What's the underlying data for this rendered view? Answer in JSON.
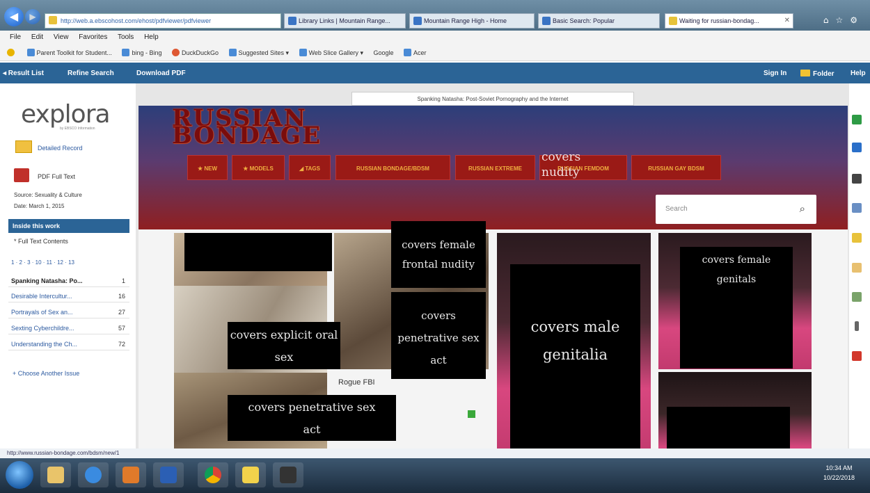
{
  "browser": {
    "address": "http://web.a.ebscohost.com/ehost/pdfviewer/pdfviewer",
    "tabs": [
      {
        "label": "Library Links | Mountain Range..."
      },
      {
        "label": "Mountain Range High - Home"
      },
      {
        "label": "Basic Search: Popular"
      },
      {
        "label": "Waiting for russian-bondag..."
      }
    ],
    "menu": [
      "File",
      "Edit",
      "View",
      "Favorites",
      "Tools",
      "Help"
    ],
    "favorites": [
      "Parent Toolkit for Student...",
      "bing - Bing",
      "DuckDuckGo",
      "Suggested Sites ▾",
      "Web Slice Gallery ▾",
      "Google",
      "Acer"
    ]
  },
  "toolbar": {
    "result_list": "◂ Result List",
    "refine_search": "Refine Search",
    "download_pdf": "Download PDF",
    "sign_in": "Sign In",
    "folder": "Folder",
    "help": "Help"
  },
  "sidebar": {
    "logo": "explora",
    "logo_sub": "by EBSCO Information",
    "detailed_record": "Detailed Record",
    "pdf_full_text": "PDF Full Text",
    "source": "Source: Sexuality & Culture",
    "date": "Date: March 1, 2015",
    "inside_this_work": "Inside this work",
    "full_text_contents": "* Full Text Contents",
    "pager": "1 · 2 · 3 · 10 · 11 · 12 · 13",
    "toc": [
      {
        "title": "Spanking Natasha: Po...",
        "page": "1"
      },
      {
        "title": "Desirable Intercultur...",
        "page": "16"
      },
      {
        "title": "Portrayals of Sex an...",
        "page": "27"
      },
      {
        "title": "Sexting Cyberchildre...",
        "page": "57"
      },
      {
        "title": "Understanding the Ch...",
        "page": "72"
      }
    ],
    "choose_issue": "+ Choose Another Issue"
  },
  "document_title": "Spanking Natasha: Post-Soviet Pornography and the Internet",
  "site": {
    "logo_line1": "RUSSIAN",
    "logo_line2": "BONDAGE",
    "menu": [
      "★ NEW",
      "★ MODELS",
      "◢ TAGS",
      "RUSSIAN BONDAGE/BDSM",
      "RUSSIAN EXTREME",
      "RUSSIAN FEMDOM",
      "RUSSIAN GAY BDSM"
    ],
    "search_placeholder": "Search",
    "caption": "Rogue FBI"
  },
  "covers": {
    "nudity": "covers nudity",
    "female_frontal": "covers female frontal nudity",
    "explicit_oral": "covers explicit oral sex",
    "penetrative_1": "covers penetrative sex act",
    "penetrative_2": "covers penetrative sex act",
    "male_genitalia": "covers male genitalia",
    "female_genitals": "covers female genitals"
  },
  "status_url": "http://www.russian-bondage.com/bdsm/new/1",
  "clock": {
    "time": "10:34 AM",
    "date": "10/22/2018"
  },
  "colors": {
    "explora_blue": "#2b6496",
    "site_red": "#8f1f20",
    "menu_orange": "#f0b040"
  }
}
